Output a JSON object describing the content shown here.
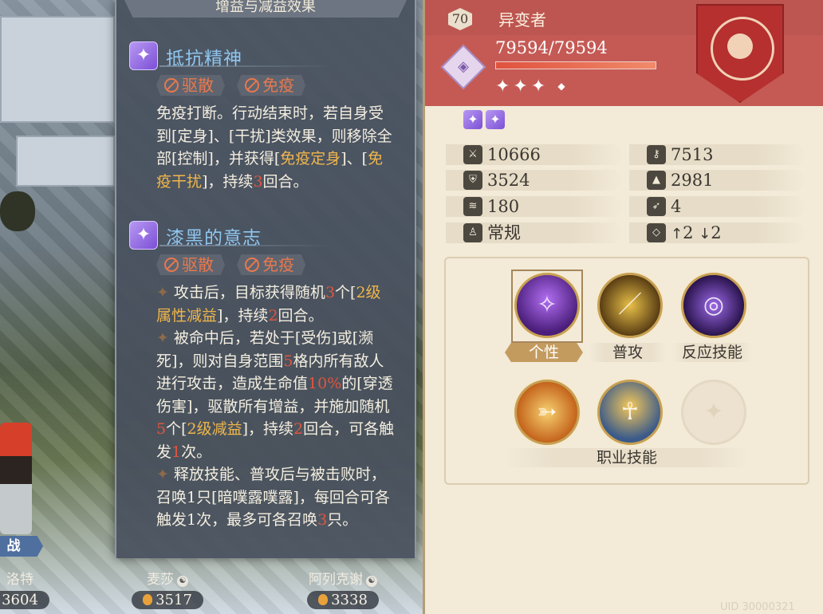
{
  "buff_panel": {
    "title": "增益与减益效果",
    "buffs": [
      {
        "icon": "sparkle-buff-icon",
        "name": "抵抗精神",
        "tags": [
          "驱散",
          "免疫"
        ],
        "desc": [
          {
            "t": "免疫打断。行动结束时，若自身受到[定身]、[干扰]类效果，则移除全部[控制]，并获得[",
            "c": ""
          },
          {
            "t": "免疫定身",
            "c": "hl"
          },
          {
            "t": "]、[",
            "c": ""
          },
          {
            "t": "免疫干扰",
            "c": "hl"
          },
          {
            "t": "]，持续",
            "c": ""
          },
          {
            "t": "3",
            "c": "num"
          },
          {
            "t": "回合。",
            "c": ""
          }
        ]
      },
      {
        "icon": "sparkle-buff-icon",
        "name": "漆黑的意志",
        "tags": [
          "驱散",
          "免疫"
        ],
        "desc": [
          {
            "t": "✦",
            "c": "star"
          },
          {
            "t": "攻击后，目标获得随机",
            "c": ""
          },
          {
            "t": "3",
            "c": "num"
          },
          {
            "t": "个[",
            "c": ""
          },
          {
            "t": "2级属性减益",
            "c": "hl"
          },
          {
            "t": "]，持续",
            "c": ""
          },
          {
            "t": "2",
            "c": "num"
          },
          {
            "t": "回合。",
            "c": ""
          },
          {
            "t": "\n",
            "c": "br"
          },
          {
            "t": "✦",
            "c": "star"
          },
          {
            "t": "被命中后，若处于[受伤]或[濒死]，则对自身范围",
            "c": ""
          },
          {
            "t": "5",
            "c": "num"
          },
          {
            "t": "格内所有敌人进行攻击，造成生命值",
            "c": ""
          },
          {
            "t": "10%",
            "c": "num"
          },
          {
            "t": "的[穿透伤害]，驱散所有增益，并施加随机",
            "c": ""
          },
          {
            "t": "5",
            "c": "num"
          },
          {
            "t": "个[",
            "c": ""
          },
          {
            "t": "2级减益",
            "c": "hl"
          },
          {
            "t": "]，持续",
            "c": ""
          },
          {
            "t": "2",
            "c": "num"
          },
          {
            "t": "回合，可各触发",
            "c": ""
          },
          {
            "t": "1",
            "c": "num"
          },
          {
            "t": "次。",
            "c": ""
          },
          {
            "t": "\n",
            "c": "br"
          },
          {
            "t": "✦",
            "c": "star"
          },
          {
            "t": "释放技能、普攻后与被击败时，召唤1只[暗噗露噗露]，每回合可各触发1次，最多可各召唤",
            "c": ""
          },
          {
            "t": "3",
            "c": "num"
          },
          {
            "t": "只。",
            "c": ""
          }
        ]
      }
    ]
  },
  "background": {
    "units": [
      {
        "name": "洛特",
        "power": "3604"
      },
      {
        "name": "麦莎",
        "power": "3517"
      },
      {
        "name": "阿列克谢",
        "power": "3338"
      }
    ],
    "deploy_label": "战",
    "deploy_label_faded": "出战"
  },
  "character": {
    "level": "70",
    "name": "异变者",
    "hp": "79594/79594",
    "hp_fraction": 1.0,
    "stars": "✦✦✦",
    "stats": {
      "attack": "10666",
      "magic": "7513",
      "defense": "3524",
      "resistance": "2981",
      "speed": "180",
      "move": "4",
      "type": "常规",
      "jump_up": "2",
      "jump_down": "2"
    },
    "skills": {
      "personal_label": "个性",
      "attack_label": "普攻",
      "reaction_label": "反应技能",
      "job_label": "职业技能"
    },
    "uid": "UID 30000321"
  },
  "colors": {
    "header_red": "#c55a55",
    "panel_bg": "#f3ead8",
    "buff_name": "#8fc6ef",
    "highlight": "#f0b64c",
    "number": "#e0553f"
  }
}
